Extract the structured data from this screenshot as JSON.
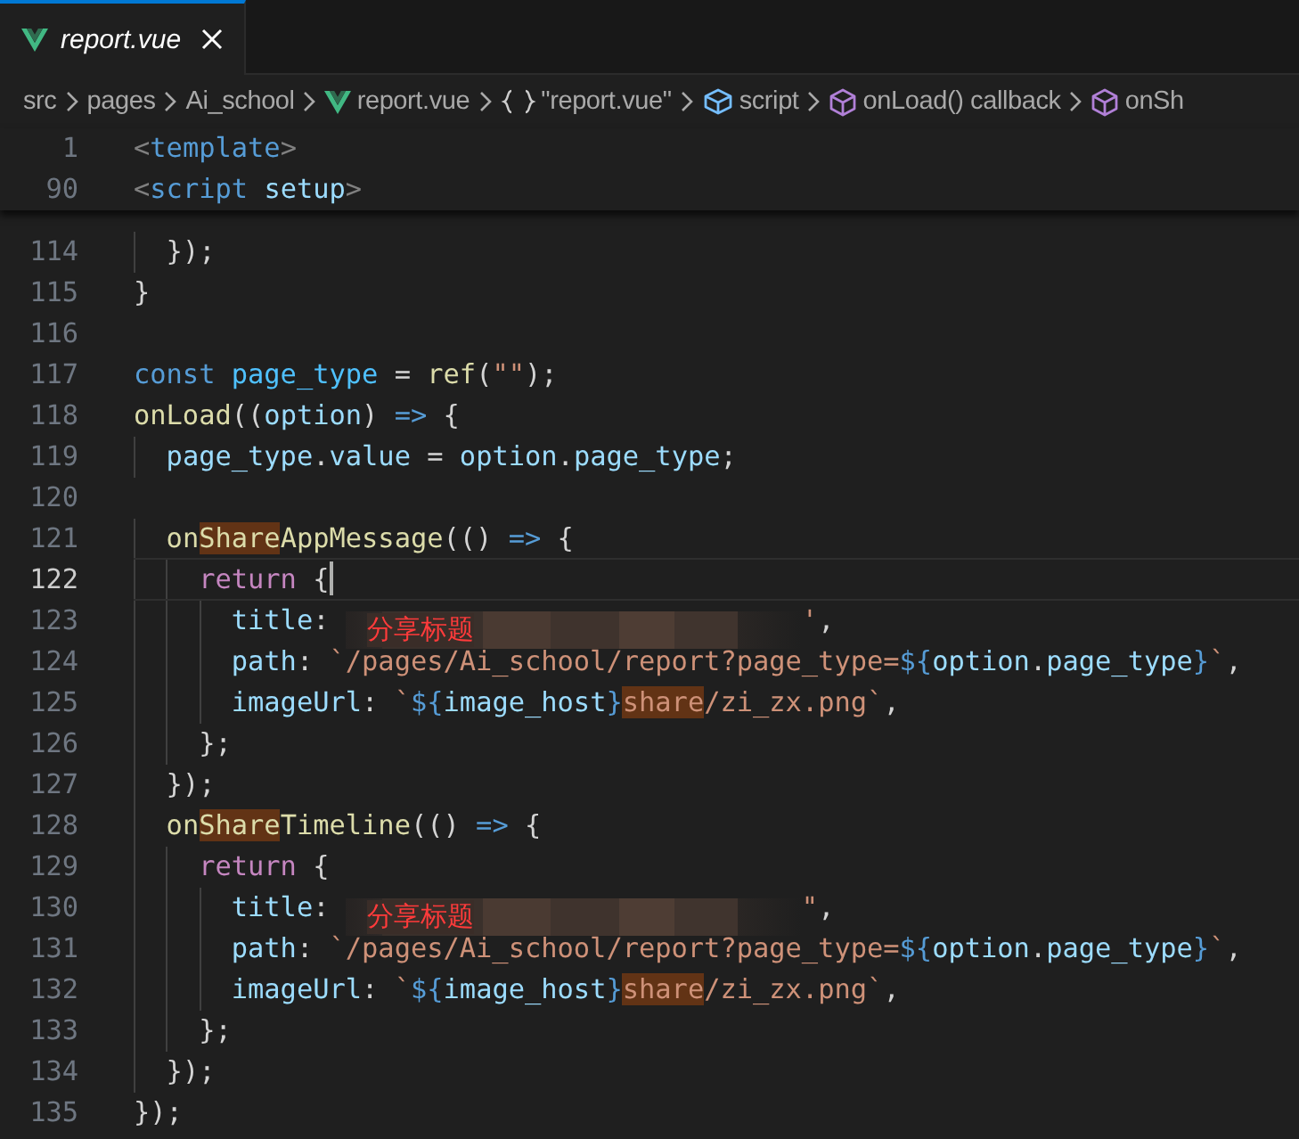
{
  "tabs": [
    {
      "label": "report.vue",
      "kind": "vue",
      "selected": true
    }
  ],
  "breadcrumbs": [
    {
      "label": "src",
      "kind": "folder"
    },
    {
      "label": "pages",
      "kind": "folder"
    },
    {
      "label": "Ai_school",
      "kind": "folder"
    },
    {
      "label": "report.vue",
      "kind": "vue"
    },
    {
      "label": "\"report.vue\"",
      "kind": "module"
    },
    {
      "label": "script",
      "kind": "element"
    },
    {
      "label": "onLoad() callback",
      "kind": "method"
    },
    {
      "label": "onSh",
      "kind": "method"
    }
  ],
  "sticky_lines": [
    {
      "number": "1",
      "tokens": [
        {
          "text": "<",
          "kind": "tagp"
        },
        {
          "text": "template",
          "kind": "tag"
        },
        {
          "text": ">",
          "kind": "tagp"
        }
      ]
    },
    {
      "number": "90",
      "tokens": [
        {
          "text": "<",
          "kind": "tagp"
        },
        {
          "text": "script",
          "kind": "tag"
        },
        {
          "text": " setup",
          "kind": "var"
        },
        {
          "text": ">",
          "kind": "tagp"
        }
      ]
    }
  ],
  "lines": [
    {
      "number": "114",
      "current": false,
      "tokens": [
        {
          "text": "  });",
          "kind": "punct"
        }
      ]
    },
    {
      "number": "115",
      "current": false,
      "tokens": [
        {
          "text": "}",
          "kind": "punct"
        }
      ]
    },
    {
      "number": "116",
      "current": false
    },
    {
      "number": "117",
      "current": false,
      "tokens": [
        {
          "text": "const",
          "kind": "kw"
        },
        {
          "text": " page_type",
          "kind": "cvar"
        },
        {
          "text": " = ",
          "kind": "punct"
        },
        {
          "text": "ref",
          "kind": "fn"
        },
        {
          "text": "(",
          "kind": "punct"
        },
        {
          "text": "\"\"",
          "kind": "str"
        },
        {
          "text": ");",
          "kind": "punct"
        }
      ]
    },
    {
      "number": "118",
      "current": false,
      "tokens": [
        {
          "text": "onLoad",
          "kind": "fn"
        },
        {
          "text": "((",
          "kind": "punct"
        },
        {
          "text": "option",
          "kind": "var"
        },
        {
          "text": ") ",
          "kind": "punct"
        },
        {
          "text": "=>",
          "kind": "kw"
        },
        {
          "text": " {",
          "kind": "punct"
        }
      ]
    },
    {
      "number": "119",
      "current": false,
      "tokens": [
        {
          "text": "  page_type",
          "kind": "var"
        },
        {
          "text": ".",
          "kind": "punct"
        },
        {
          "text": "value",
          "kind": "var"
        },
        {
          "text": " = ",
          "kind": "punct"
        },
        {
          "text": "option",
          "kind": "var"
        },
        {
          "text": ".",
          "kind": "punct"
        },
        {
          "text": "page_type",
          "kind": "var"
        },
        {
          "text": ";",
          "kind": "punct"
        }
      ]
    },
    {
      "number": "120",
      "current": false
    },
    {
      "number": "121",
      "current": false,
      "tokens": [
        {
          "text": "  on",
          "kind": "fn"
        },
        {
          "text": "Share",
          "kind": "fn-hit"
        },
        {
          "text": "AppMessage",
          "kind": "fn"
        },
        {
          "text": "(() ",
          "kind": "punct"
        },
        {
          "text": "=>",
          "kind": "kw"
        },
        {
          "text": " {",
          "kind": "punct"
        }
      ]
    },
    {
      "number": "122",
      "current": true,
      "tokens": [
        {
          "text": "    return",
          "kind": "ctrl"
        },
        {
          "text": " {",
          "kind": "punct"
        }
      ]
    },
    {
      "number": "123",
      "current": false,
      "tokens": [
        {
          "text": "      title",
          "kind": "var"
        },
        {
          "text": ": ",
          "kind": "punct"
        },
        {
          "kind": "redacted",
          "note": "分享标题"
        },
        {
          "text": "'",
          "kind": "str"
        },
        {
          "text": ",",
          "kind": "punct"
        }
      ]
    },
    {
      "number": "124",
      "current": false,
      "tokens": [
        {
          "text": "      path",
          "kind": "var"
        },
        {
          "text": ": ",
          "kind": "punct"
        },
        {
          "text": "`/pages/Ai_school/report?page_type=",
          "kind": "str"
        },
        {
          "text": "${",
          "kind": "tmpl"
        },
        {
          "text": "option",
          "kind": "var"
        },
        {
          "text": ".",
          "kind": "punct"
        },
        {
          "text": "page_type",
          "kind": "var"
        },
        {
          "text": "}",
          "kind": "tmpl"
        },
        {
          "text": "`",
          "kind": "str"
        },
        {
          "text": ",",
          "kind": "punct"
        }
      ]
    },
    {
      "number": "125",
      "current": false,
      "tokens": [
        {
          "text": "      imageUrl",
          "kind": "var"
        },
        {
          "text": ": ",
          "kind": "punct"
        },
        {
          "text": "`",
          "kind": "str"
        },
        {
          "text": "${",
          "kind": "tmpl"
        },
        {
          "text": "image_host",
          "kind": "var"
        },
        {
          "text": "}",
          "kind": "tmpl"
        },
        {
          "text": "share",
          "kind": "str-hit"
        },
        {
          "text": "/zi_zx.png`",
          "kind": "str"
        },
        {
          "text": ",",
          "kind": "punct"
        }
      ]
    },
    {
      "number": "126",
      "current": false,
      "tokens": [
        {
          "text": "    };",
          "kind": "punct"
        }
      ]
    },
    {
      "number": "127",
      "current": false,
      "tokens": [
        {
          "text": "  });",
          "kind": "punct"
        }
      ]
    },
    {
      "number": "128",
      "current": false,
      "tokens": [
        {
          "text": "  on",
          "kind": "fn"
        },
        {
          "text": "Share",
          "kind": "fn-hit"
        },
        {
          "text": "Timeline",
          "kind": "fn"
        },
        {
          "text": "(() ",
          "kind": "punct"
        },
        {
          "text": "=>",
          "kind": "kw"
        },
        {
          "text": " {",
          "kind": "punct"
        }
      ]
    },
    {
      "number": "129",
      "current": false,
      "tokens": [
        {
          "text": "    return",
          "kind": "ctrl"
        },
        {
          "text": " {",
          "kind": "punct"
        }
      ]
    },
    {
      "number": "130",
      "current": false,
      "tokens": [
        {
          "text": "      title",
          "kind": "var"
        },
        {
          "text": ": ",
          "kind": "punct"
        },
        {
          "kind": "redacted",
          "note": "分享标题"
        },
        {
          "text": "\"",
          "kind": "str"
        },
        {
          "text": ",",
          "kind": "punct"
        }
      ]
    },
    {
      "number": "131",
      "current": false,
      "tokens": [
        {
          "text": "      path",
          "kind": "var"
        },
        {
          "text": ": ",
          "kind": "punct"
        },
        {
          "text": "`/pages/Ai_school/report?page_type=",
          "kind": "str"
        },
        {
          "text": "${",
          "kind": "tmpl"
        },
        {
          "text": "option",
          "kind": "var"
        },
        {
          "text": ".",
          "kind": "punct"
        },
        {
          "text": "page_type",
          "kind": "var"
        },
        {
          "text": "}",
          "kind": "tmpl"
        },
        {
          "text": "`",
          "kind": "str"
        },
        {
          "text": ",",
          "kind": "punct"
        }
      ]
    },
    {
      "number": "132",
      "current": false,
      "tokens": [
        {
          "text": "      imageUrl",
          "kind": "var"
        },
        {
          "text": ": ",
          "kind": "punct"
        },
        {
          "text": "`",
          "kind": "str"
        },
        {
          "text": "${",
          "kind": "tmpl"
        },
        {
          "text": "image_host",
          "kind": "var"
        },
        {
          "text": "}",
          "kind": "tmpl"
        },
        {
          "text": "share",
          "kind": "str-hit"
        },
        {
          "text": "/zi_zx.png`",
          "kind": "str"
        },
        {
          "text": ",",
          "kind": "punct"
        }
      ]
    },
    {
      "number": "133",
      "current": false,
      "tokens": [
        {
          "text": "    };",
          "kind": "punct"
        }
      ]
    },
    {
      "number": "134",
      "current": false,
      "tokens": [
        {
          "text": "  });",
          "kind": "punct"
        }
      ]
    },
    {
      "number": "135",
      "current": false,
      "tokens": [
        {
          "text": "});",
          "kind": "punct"
        }
      ]
    }
  ]
}
